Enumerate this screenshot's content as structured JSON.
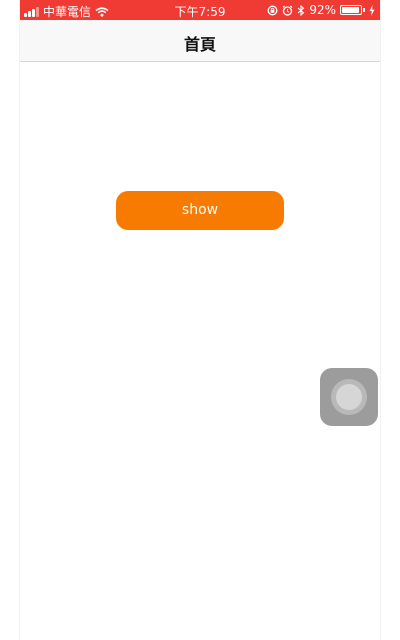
{
  "status_bar": {
    "carrier": "中華電信",
    "time": "下午7:59",
    "battery_percent_label": "92%",
    "battery_level": 0.92
  },
  "nav": {
    "title": "首頁"
  },
  "main": {
    "show_button_label": "show"
  },
  "colors": {
    "status_bar_bg": "#ef3b34",
    "button_bg": "#f77b00",
    "nav_bg": "#f8f8f8"
  },
  "icons": {
    "signal": "signal-bars-icon",
    "wifi": "wifi-icon",
    "lock_rotation": "rotation-lock-icon",
    "alarm": "alarm-icon",
    "bluetooth": "bluetooth-icon",
    "battery": "battery-icon",
    "charging": "charging-bolt-icon",
    "assistive_touch": "assistive-touch-icon"
  }
}
